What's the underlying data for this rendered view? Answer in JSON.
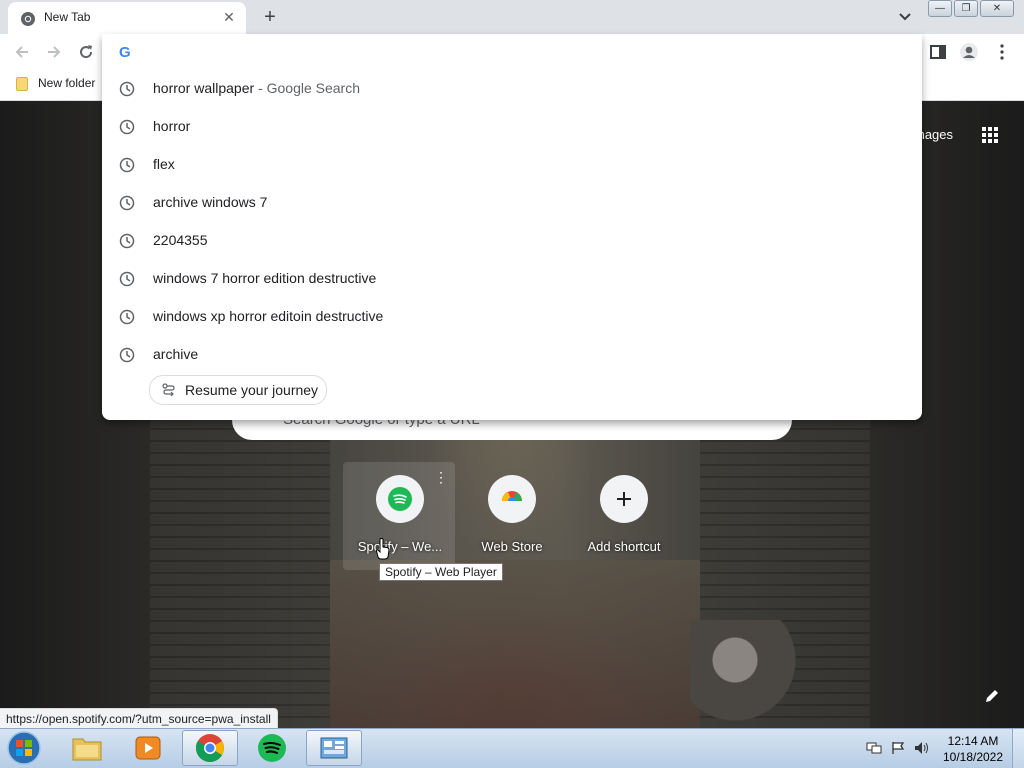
{
  "tab": {
    "title": "New Tab",
    "close": "✕"
  },
  "toolbar": {
    "new_tab": "+"
  },
  "bookmarks": {
    "folder": "New folder"
  },
  "omnibox": {
    "value": "",
    "suggestions": [
      {
        "text": "horror wallpaper",
        "sub": "- Google Search"
      },
      {
        "text": "horror",
        "sub": ""
      },
      {
        "text": "flex",
        "sub": ""
      },
      {
        "text": "archive windows 7",
        "sub": ""
      },
      {
        "text": "2204355",
        "sub": ""
      },
      {
        "text": "windows 7 horror edition destructive",
        "sub": ""
      },
      {
        "text": "windows xp horror editoin destructive",
        "sub": ""
      },
      {
        "text": "archive",
        "sub": ""
      }
    ],
    "journey_label": "Resume your journey"
  },
  "ntp": {
    "images_link": "mages",
    "search_placeholder": "Search Google or type a URL",
    "shortcuts": [
      {
        "label": "Spotify – We...",
        "icon": "spotify-icon"
      },
      {
        "label": "Web Store",
        "icon": "web-store-icon"
      },
      {
        "label": "Add shortcut",
        "icon": "plus-icon"
      }
    ],
    "tooltip": "Spotify – Web Player"
  },
  "status_url": "https://open.spotify.com/?utm_source=pwa_install",
  "taskbar": {
    "time": "12:14 AM",
    "date": "10/18/2022"
  },
  "colors": {
    "spotify": "#1db954",
    "google_blue": "#4285f4",
    "taskbar": "#c6d6e8"
  }
}
